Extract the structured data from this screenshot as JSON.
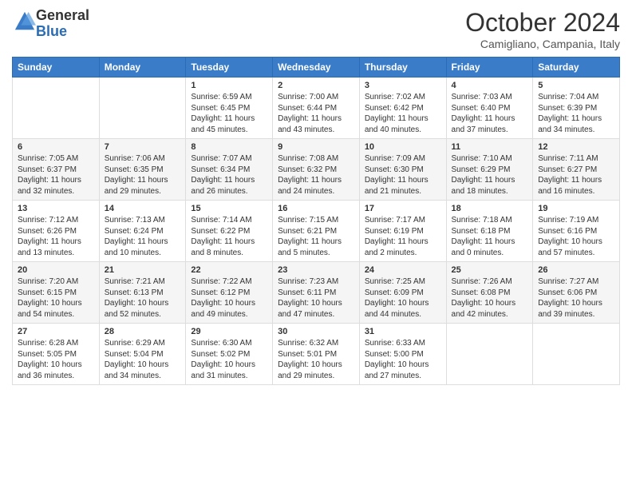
{
  "logo": {
    "general": "General",
    "blue": "Blue"
  },
  "title": "October 2024",
  "location": "Camigliano, Campania, Italy",
  "days_of_week": [
    "Sunday",
    "Monday",
    "Tuesday",
    "Wednesday",
    "Thursday",
    "Friday",
    "Saturday"
  ],
  "weeks": [
    [
      {
        "day": "",
        "text": ""
      },
      {
        "day": "",
        "text": ""
      },
      {
        "day": "1",
        "text": "Sunrise: 6:59 AM\nSunset: 6:45 PM\nDaylight: 11 hours and 45 minutes."
      },
      {
        "day": "2",
        "text": "Sunrise: 7:00 AM\nSunset: 6:44 PM\nDaylight: 11 hours and 43 minutes."
      },
      {
        "day": "3",
        "text": "Sunrise: 7:02 AM\nSunset: 6:42 PM\nDaylight: 11 hours and 40 minutes."
      },
      {
        "day": "4",
        "text": "Sunrise: 7:03 AM\nSunset: 6:40 PM\nDaylight: 11 hours and 37 minutes."
      },
      {
        "day": "5",
        "text": "Sunrise: 7:04 AM\nSunset: 6:39 PM\nDaylight: 11 hours and 34 minutes."
      }
    ],
    [
      {
        "day": "6",
        "text": "Sunrise: 7:05 AM\nSunset: 6:37 PM\nDaylight: 11 hours and 32 minutes."
      },
      {
        "day": "7",
        "text": "Sunrise: 7:06 AM\nSunset: 6:35 PM\nDaylight: 11 hours and 29 minutes."
      },
      {
        "day": "8",
        "text": "Sunrise: 7:07 AM\nSunset: 6:34 PM\nDaylight: 11 hours and 26 minutes."
      },
      {
        "day": "9",
        "text": "Sunrise: 7:08 AM\nSunset: 6:32 PM\nDaylight: 11 hours and 24 minutes."
      },
      {
        "day": "10",
        "text": "Sunrise: 7:09 AM\nSunset: 6:30 PM\nDaylight: 11 hours and 21 minutes."
      },
      {
        "day": "11",
        "text": "Sunrise: 7:10 AM\nSunset: 6:29 PM\nDaylight: 11 hours and 18 minutes."
      },
      {
        "day": "12",
        "text": "Sunrise: 7:11 AM\nSunset: 6:27 PM\nDaylight: 11 hours and 16 minutes."
      }
    ],
    [
      {
        "day": "13",
        "text": "Sunrise: 7:12 AM\nSunset: 6:26 PM\nDaylight: 11 hours and 13 minutes."
      },
      {
        "day": "14",
        "text": "Sunrise: 7:13 AM\nSunset: 6:24 PM\nDaylight: 11 hours and 10 minutes."
      },
      {
        "day": "15",
        "text": "Sunrise: 7:14 AM\nSunset: 6:22 PM\nDaylight: 11 hours and 8 minutes."
      },
      {
        "day": "16",
        "text": "Sunrise: 7:15 AM\nSunset: 6:21 PM\nDaylight: 11 hours and 5 minutes."
      },
      {
        "day": "17",
        "text": "Sunrise: 7:17 AM\nSunset: 6:19 PM\nDaylight: 11 hours and 2 minutes."
      },
      {
        "day": "18",
        "text": "Sunrise: 7:18 AM\nSunset: 6:18 PM\nDaylight: 11 hours and 0 minutes."
      },
      {
        "day": "19",
        "text": "Sunrise: 7:19 AM\nSunset: 6:16 PM\nDaylight: 10 hours and 57 minutes."
      }
    ],
    [
      {
        "day": "20",
        "text": "Sunrise: 7:20 AM\nSunset: 6:15 PM\nDaylight: 10 hours and 54 minutes."
      },
      {
        "day": "21",
        "text": "Sunrise: 7:21 AM\nSunset: 6:13 PM\nDaylight: 10 hours and 52 minutes."
      },
      {
        "day": "22",
        "text": "Sunrise: 7:22 AM\nSunset: 6:12 PM\nDaylight: 10 hours and 49 minutes."
      },
      {
        "day": "23",
        "text": "Sunrise: 7:23 AM\nSunset: 6:11 PM\nDaylight: 10 hours and 47 minutes."
      },
      {
        "day": "24",
        "text": "Sunrise: 7:25 AM\nSunset: 6:09 PM\nDaylight: 10 hours and 44 minutes."
      },
      {
        "day": "25",
        "text": "Sunrise: 7:26 AM\nSunset: 6:08 PM\nDaylight: 10 hours and 42 minutes."
      },
      {
        "day": "26",
        "text": "Sunrise: 7:27 AM\nSunset: 6:06 PM\nDaylight: 10 hours and 39 minutes."
      }
    ],
    [
      {
        "day": "27",
        "text": "Sunrise: 6:28 AM\nSunset: 5:05 PM\nDaylight: 10 hours and 36 minutes."
      },
      {
        "day": "28",
        "text": "Sunrise: 6:29 AM\nSunset: 5:04 PM\nDaylight: 10 hours and 34 minutes."
      },
      {
        "day": "29",
        "text": "Sunrise: 6:30 AM\nSunset: 5:02 PM\nDaylight: 10 hours and 31 minutes."
      },
      {
        "day": "30",
        "text": "Sunrise: 6:32 AM\nSunset: 5:01 PM\nDaylight: 10 hours and 29 minutes."
      },
      {
        "day": "31",
        "text": "Sunrise: 6:33 AM\nSunset: 5:00 PM\nDaylight: 10 hours and 27 minutes."
      },
      {
        "day": "",
        "text": ""
      },
      {
        "day": "",
        "text": ""
      }
    ]
  ]
}
